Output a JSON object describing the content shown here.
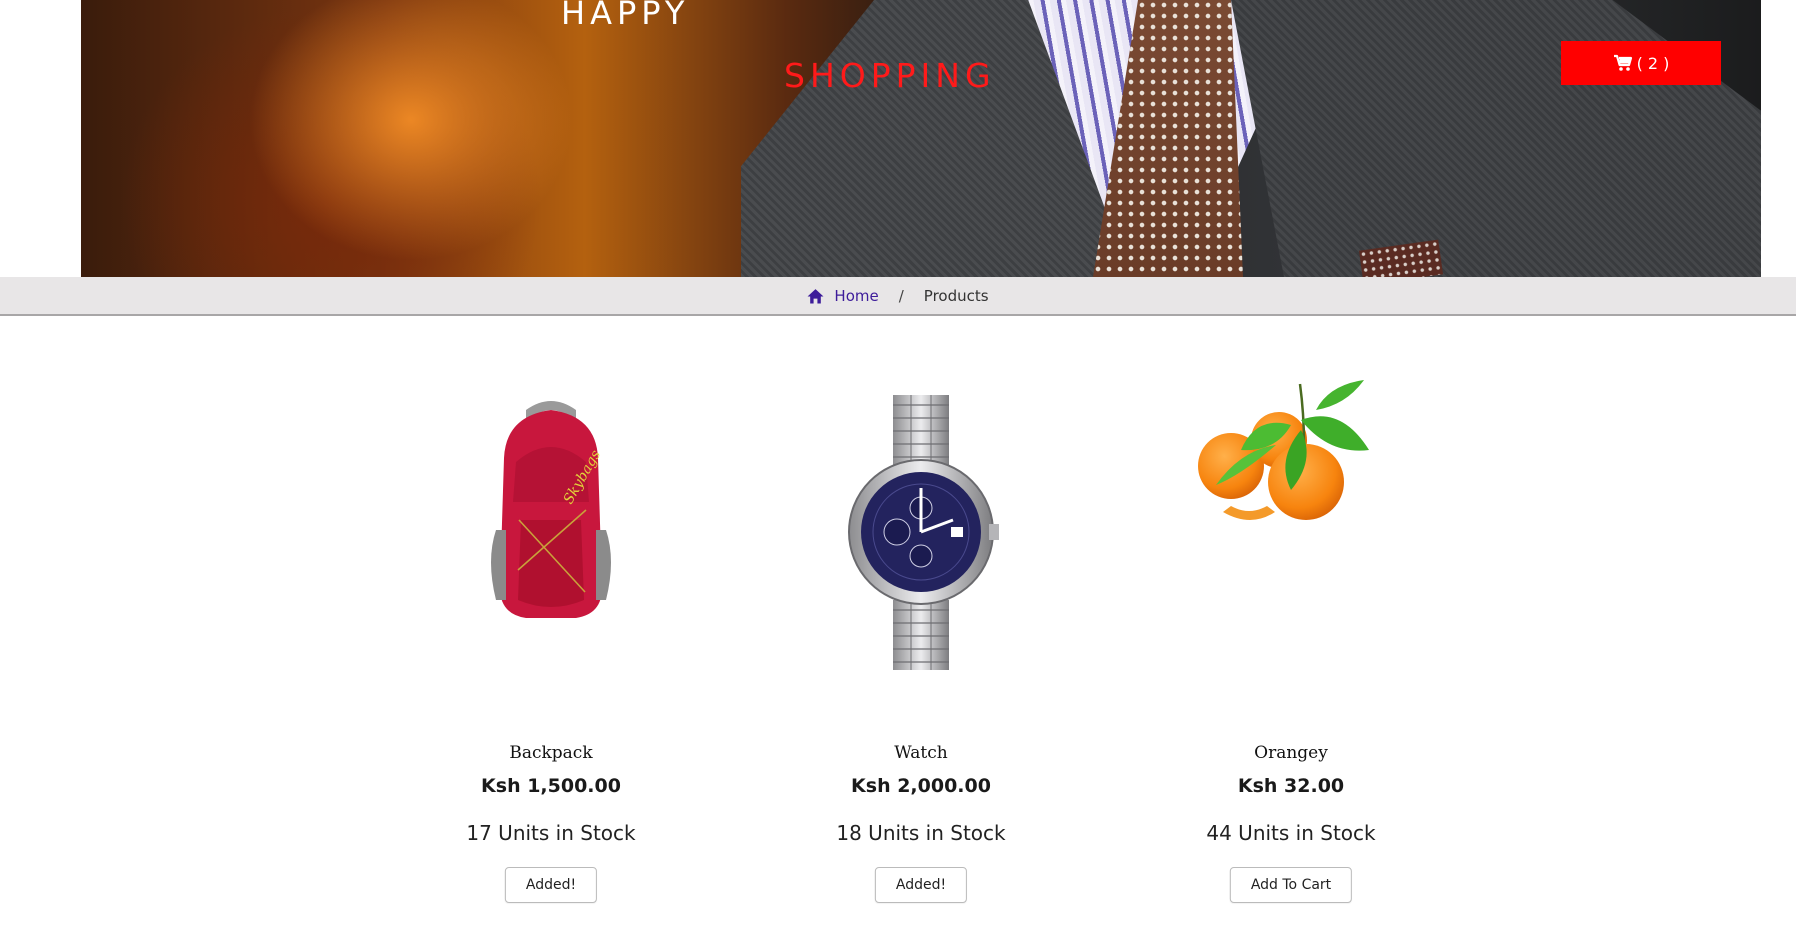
{
  "header": {
    "title_line1": "HAPPY",
    "title_line2": "SHOPPING",
    "cart_label": "( 2 )",
    "cart_icon": "shopping-cart-icon"
  },
  "breadcrumb": {
    "home_icon": "home-icon",
    "home_label": "Home",
    "separator": "/",
    "current": "Products"
  },
  "products": [
    {
      "name": "Backpack",
      "price": "Ksh 1,500.00",
      "stock": "17 Units in Stock",
      "button_label": "Added!",
      "image": "backpack-image"
    },
    {
      "name": "Watch",
      "price": "Ksh 2,000.00",
      "stock": "18 Units in Stock",
      "button_label": "Added!",
      "image": "watch-image"
    },
    {
      "name": "Orangey",
      "price": "Ksh 32.00",
      "stock": "44 Units in Stock",
      "button_label": "Add To Cart",
      "image": "oranges-image"
    }
  ],
  "colors": {
    "accent": "#ff0000",
    "link": "#3d1c9a",
    "breadcrumb_bg": "#e8e6e7"
  }
}
